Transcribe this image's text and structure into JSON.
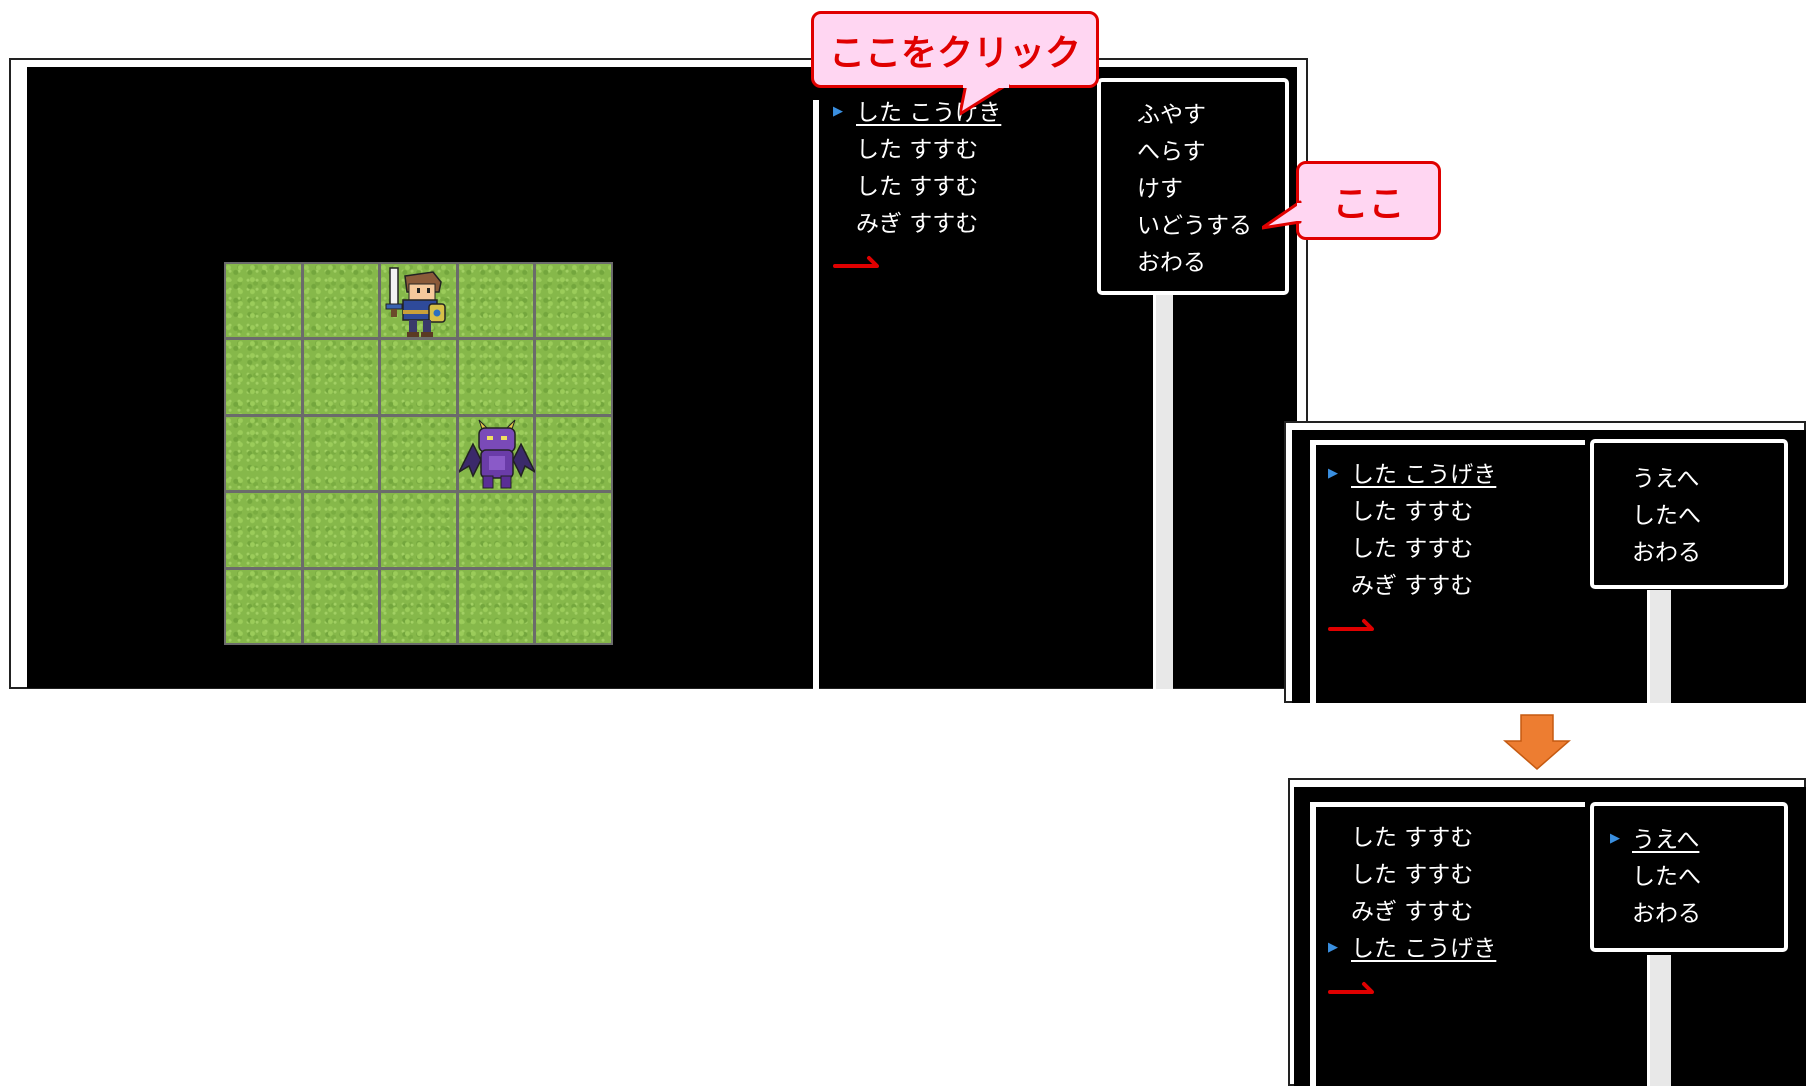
{
  "callouts": {
    "click_here": "ここをクリック",
    "here": "ここ"
  },
  "main": {
    "commands": [
      "した こうげき",
      "した すすむ",
      "した すすむ",
      "みぎ すすむ"
    ],
    "context_menu": [
      "ふやす",
      "へらす",
      "けす",
      "いどうする",
      "おわる"
    ]
  },
  "before": {
    "commands": [
      "した こうげき",
      "した すすむ",
      "した すすむ",
      "みぎ すすむ"
    ],
    "submenu": [
      "うえへ",
      "したへ",
      "おわる"
    ]
  },
  "after": {
    "commands": [
      "した すすむ",
      "した すすむ",
      "みぎ すすむ",
      "した こうげき"
    ],
    "submenu": [
      "うえへ",
      "したへ",
      "おわる"
    ]
  },
  "colors": {
    "accent_red": "#e00000",
    "callout_bg": "#ffd6f2",
    "arrow_orange": "#ed7d31",
    "cursor_blue": "#3a8fe0",
    "grass": "#86b84a"
  },
  "icons": {
    "hero": "hero-knight-icon",
    "demon": "purple-demon-icon",
    "cursor": "blue-triangle-cursor-icon",
    "next": "red-arrow-icon",
    "transition": "down-arrow-icon"
  }
}
